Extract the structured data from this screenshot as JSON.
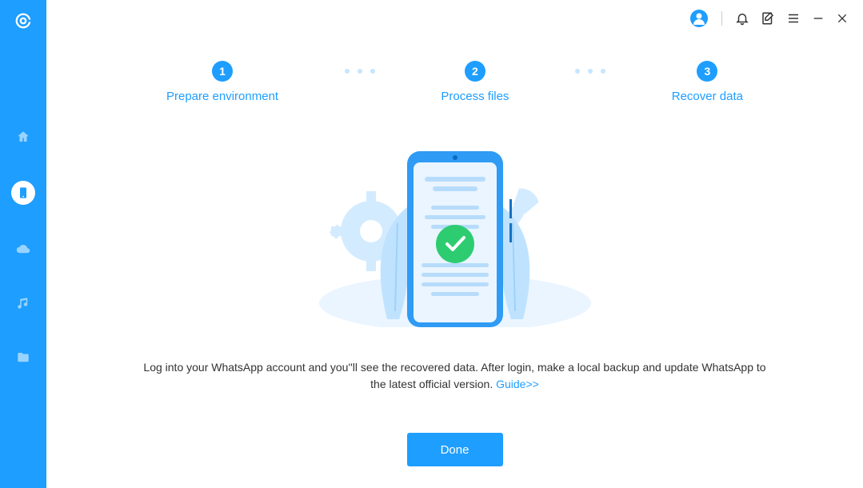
{
  "sidebar": {
    "items": [
      {
        "name": "home-icon"
      },
      {
        "name": "phone-icon"
      },
      {
        "name": "cloud-icon"
      },
      {
        "name": "music-icon"
      },
      {
        "name": "folder-icon"
      }
    ]
  },
  "titlebar": {
    "account": "account",
    "bell": "notifications",
    "sheet": "feedback",
    "menu": "menu",
    "minimize": "minimize",
    "close": "close"
  },
  "steps": {
    "s1_num": "1",
    "s1_label": "Prepare environment",
    "s2_num": "2",
    "s2_label": "Process files",
    "s3_num": "3",
    "s3_label": "Recover data"
  },
  "message": {
    "text": "Log into your WhatsApp account and you''ll see the recovered data. After login, make a local backup and update WhatsApp to the latest official version. ",
    "link": "Guide>>"
  },
  "actions": {
    "done": "Done"
  }
}
